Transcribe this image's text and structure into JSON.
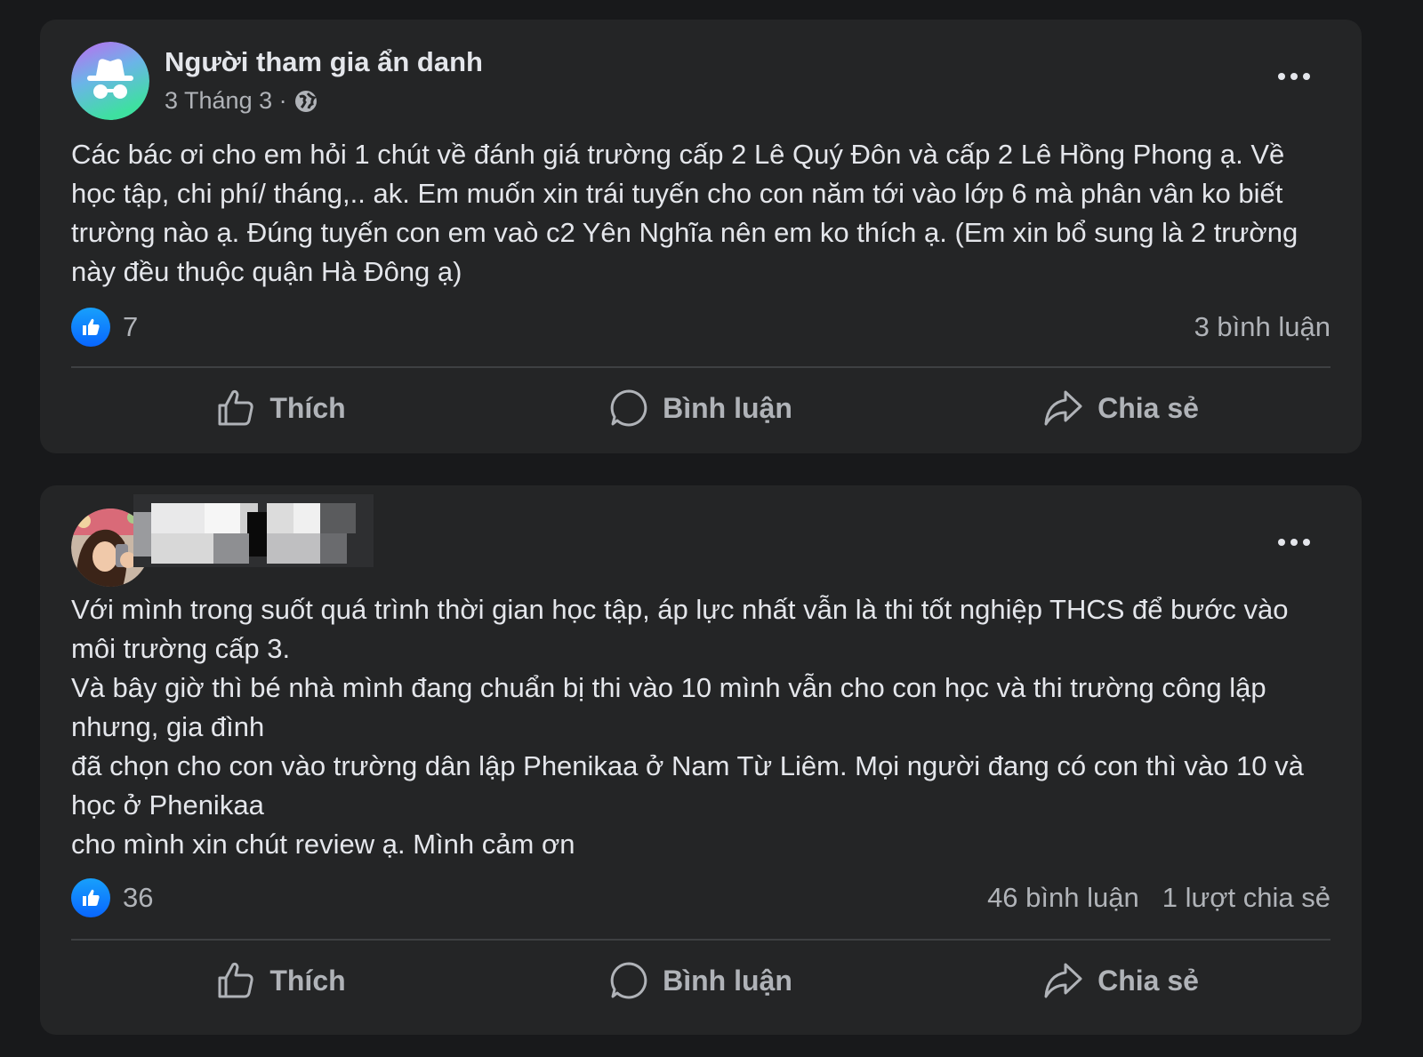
{
  "posts": [
    {
      "author": "Người tham gia ẩn danh",
      "date": "3 Tháng 3 ·",
      "text_lines": [
        "Các bác ơi cho em hỏi 1 chút về đánh giá trường cấp 2 Lê Quý Đôn và cấp 2 Lê Hồng Phong ạ. Về học tập, chi phí/ tháng,.. ak. Em muốn xin trái tuyến cho con năm tới vào lớp 6 mà phân vân ko biết trường nào ạ. Đúng tuyến con em vaò c2 Yên Nghĩa nên em ko thích ạ. (Em xin bổ sung là 2 trường này đều thuộc quận Hà Đông ạ)"
      ],
      "likes": "7",
      "comments": "3 bình luận",
      "shares": "",
      "actions": {
        "like": "Thích",
        "comment": "Bình luận",
        "share": "Chia sẻ"
      }
    },
    {
      "author": "",
      "date": "",
      "text_lines": [
        "Với mình trong suốt quá trình thời gian học tập, áp lực nhất vẫn là thi tốt nghiệp THCS để bước vào môi trường cấp 3.",
        "Và bây giờ thì bé nhà mình đang chuẩn bị thi vào 10 mình vẫn cho con học và thi trường công lập nhưng, gia đình",
        "đã chọn cho con vào trường dân lập Phenikaa ở Nam Từ Liêm. Mọi người đang có con thì vào 10 và học ở Phenikaa",
        "cho mình xin chút review ạ. Mình cảm ơn"
      ],
      "likes": "36",
      "comments": "46 bình luận",
      "shares": "1 lượt chia sẻ",
      "actions": {
        "like": "Thích",
        "comment": "Bình luận",
        "share": "Chia sẻ"
      }
    }
  ],
  "colors": {
    "page_bg": "#18191b",
    "card_bg": "#242526",
    "primary_text": "#e4e6eb",
    "secondary_text": "#b0b3b8",
    "like_blue": "#0866ff",
    "divider": "#3e4042"
  },
  "icons": {
    "anonymous_avatar": "incognito-icon",
    "globe": "globe-icon",
    "more": "more-dots-icon",
    "like_badge": "thumbs-up-icon",
    "like_action": "thumbs-up-outline-icon",
    "comment_action": "comment-bubble-icon",
    "share_action": "share-arrow-icon"
  }
}
